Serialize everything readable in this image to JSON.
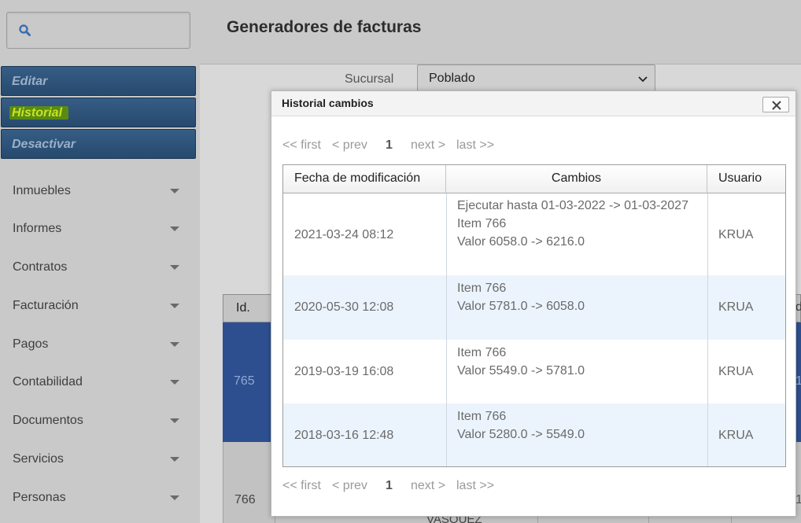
{
  "sidebar": {
    "search": {
      "placeholder": ""
    },
    "actions": [
      {
        "label": "Editar"
      },
      {
        "label": "Historial"
      },
      {
        "label": "Desactivar"
      }
    ],
    "nav": [
      {
        "label": "Inmuebles"
      },
      {
        "label": "Informes"
      },
      {
        "label": "Contratos"
      },
      {
        "label": "Facturación"
      },
      {
        "label": "Pagos"
      },
      {
        "label": "Contabilidad"
      },
      {
        "label": "Documentos"
      },
      {
        "label": "Servicios"
      },
      {
        "label": "Personas"
      }
    ]
  },
  "header": {
    "title": "Generadores de facturas"
  },
  "filter": {
    "label": "Sucursal",
    "value": "Poblado"
  },
  "background_table": {
    "header_id": "Id.",
    "rows": [
      {
        "id": "765",
        "right_fragment": "1"
      },
      {
        "id": "766",
        "text_fragment": "VASQUEZ",
        "right_fragment": "1"
      }
    ],
    "right_header_fragment": "d"
  },
  "modal": {
    "title": "Historial cambios",
    "close_icon": "close-icon",
    "pager": {
      "first": "<< first",
      "prev": "< prev",
      "current": "1",
      "next": "next >",
      "last": "last >>"
    },
    "columns": {
      "fecha": "Fecha de modificación",
      "cambios": "Cambios",
      "usuario": "Usuario"
    },
    "rows": [
      {
        "fecha": "2021-03-24 08:12",
        "cambios": [
          "Ejecutar hasta 01-03-2022 -> 01-03-2027",
          "Item 766",
          "Valor 6058.0 -> 6216.0"
        ],
        "usuario": "KRUA"
      },
      {
        "fecha": "2020-05-30 12:08",
        "cambios": [
          "Item 766",
          "Valor 5781.0 -> 6058.0"
        ],
        "usuario": "KRUA"
      },
      {
        "fecha": "2019-03-19 16:08",
        "cambios": [
          "Item 766",
          "Valor 5549.0 -> 5781.0"
        ],
        "usuario": "KRUA"
      },
      {
        "fecha": "2018-03-16 12:48",
        "cambios": [
          "Item 766",
          "Valor 5280.0 -> 5549.0"
        ],
        "usuario": "KRUA"
      }
    ]
  },
  "colors": {
    "action_button": "#274a6e",
    "highlight": "#c6e61e",
    "selected_row": "#2e4f8f",
    "alt_row": "#ebf4fd"
  }
}
